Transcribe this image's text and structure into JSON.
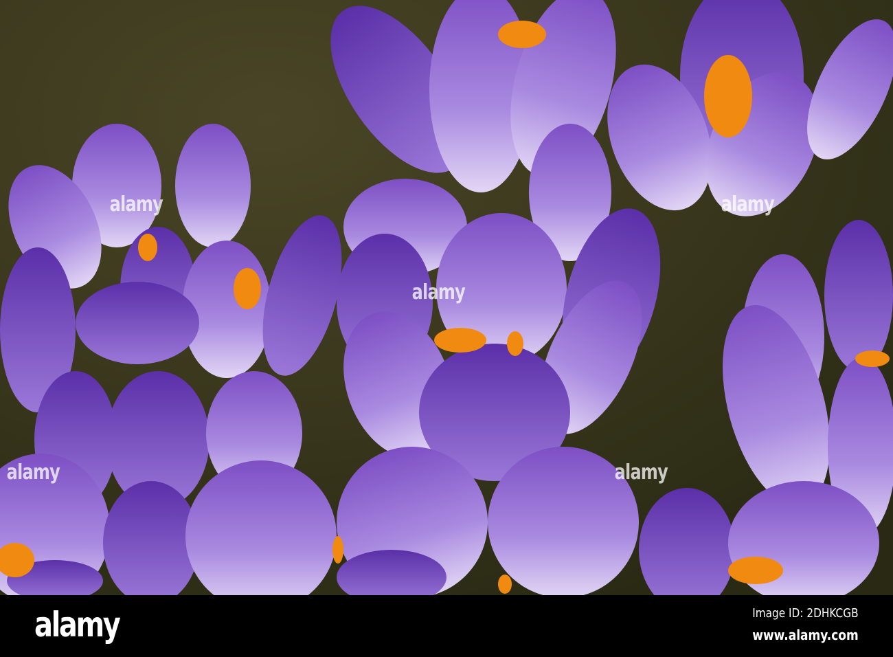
{
  "photo": {
    "subject": "purple crocus flowers",
    "colors": {
      "background": "#3b3a1c",
      "petal": "#8a5cd0",
      "petal_light": "#d9c8f2",
      "stamen": "#f08a10"
    }
  },
  "watermark": {
    "text": "alamy"
  },
  "footer": {
    "logo": "alamy",
    "image_id": "Image ID: 2DHKCGB",
    "website": "www.alamy.com"
  }
}
